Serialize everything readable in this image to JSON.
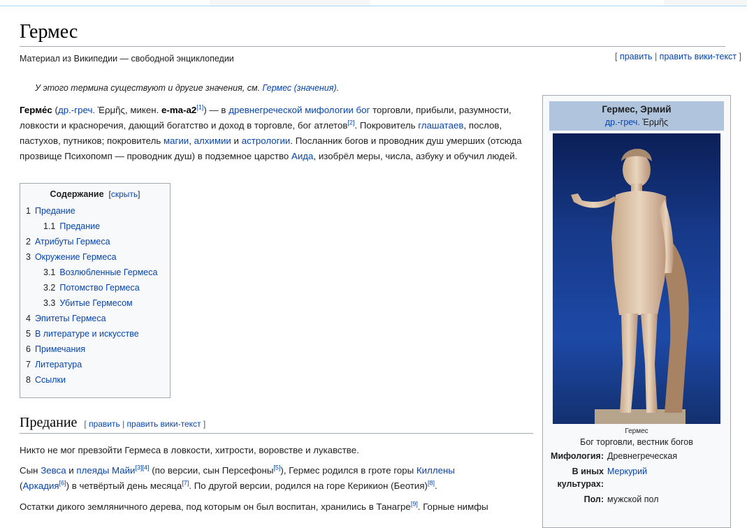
{
  "page": {
    "title": "Гермес",
    "tagline": "Материал из Википедии — свободной энциклопедии",
    "edit_links": [
      "[ ",
      "править",
      " | ",
      "править вики-текст",
      " ]"
    ],
    "hatnote_prefix": "У этого термина существуют и другие значения, см. ",
    "hatnote_link": "Гермес (значения)",
    "hatnote_suffix": "."
  },
  "lead": {
    "term": "Герме́с",
    "p1": " (",
    "lang_link": "др.-греч.",
    "greek": " Ἑρμῆς",
    "p2": ", микен. ",
    "myc": "e-ma-a2",
    "ref1": "[1]",
    "p3": ") — в ",
    "link_myth": "древнегреческой мифологии",
    "p4": " ",
    "link_god": "бог",
    "p5": " торговли, прибыли, разумности, ловкости и красноречия, дающий богатство и доход в торговле, бог атлетов",
    "ref2": "[2]",
    "p6": ". Покровитель ",
    "link_herald": "глашатаев",
    "p7": ", послов, пастухов, путников; покровитель ",
    "link_magic": "магии",
    "p8": ", ",
    "link_alch": "алхимии",
    "p9": " и ",
    "link_astro": "астрологии",
    "p10": ". Посланник богов и проводник душ умерших (отсюда прозвище Психопомп — проводник душ) в подземное царство ",
    "link_hades": "Аида",
    "p11": ", изобрёл меры, числа, азбуку и обучил людей."
  },
  "toc": {
    "heading": "Содержание",
    "hide_prefix": "[",
    "hide_link": "скрыть",
    "hide_suffix": "]",
    "items": [
      {
        "num": "1",
        "label": "Предание",
        "level": 1
      },
      {
        "num": "1.1",
        "label": "Предание",
        "level": 2
      },
      {
        "num": "2",
        "label": "Атрибуты Гермеса",
        "level": 1
      },
      {
        "num": "3",
        "label": "Окружение Гермеса",
        "level": 1
      },
      {
        "num": "3.1",
        "label": "Возлюбленные Гермеса",
        "level": 2
      },
      {
        "num": "3.2",
        "label": "Потомство Гермеса",
        "level": 2
      },
      {
        "num": "3.3",
        "label": "Убитые Гермесом",
        "level": 2
      },
      {
        "num": "4",
        "label": "Эпитеты Гермеса",
        "level": 1
      },
      {
        "num": "5",
        "label": "В литературе и искусстве",
        "level": 1
      },
      {
        "num": "6",
        "label": "Примечания",
        "level": 1
      },
      {
        "num": "7",
        "label": "Литература",
        "level": 1
      },
      {
        "num": "8",
        "label": "Ссылки",
        "level": 1
      }
    ]
  },
  "section": {
    "heading": "Предание",
    "edit_open": "[ ",
    "edit": "править",
    "sep": " | ",
    "edit_wiki": "править вики-текст",
    "edit_close": " ]",
    "para1": "Никто не мог превзойти Гермеса в ловкости, хитрости, воровстве и лукавстве.",
    "para2": {
      "t1": "Сын ",
      "zeus": "Зевса",
      "t2": " и ",
      "pleiad": "плеяды Майи",
      "r3": "[3]",
      "r4": "[4]",
      "t3": " (по версии, сын Персефоны",
      "r5": "[5]",
      "t4": "), Гермес родился в гроте горы ",
      "kyllene": "Киллены",
      "t5": " (",
      "arcadia": "Аркадия",
      "r6": "[6]",
      "t6": ") в четвёртый день месяца",
      "r7": "[7]",
      "t7": ". По другой версии, родился на горе Керикион (Беотия)",
      "r8": "[8]",
      "t8": "."
    },
    "para3": {
      "t1": "Остатки дикого земляничного дерева, под которым он был воспитан, хранились в Танагре",
      "r9": "[9]",
      "t2": ". Горные нимфы"
    }
  },
  "infobox": {
    "name": "Гермес, Эрмий",
    "lang_link": "др.-греч.",
    "greek": " Ἑρμῆς",
    "image_caption_small": "Гермес",
    "caption": "Бог торговли, вестник богов",
    "rows": [
      {
        "label": "Мифология:",
        "value": "Древнегреческая",
        "is_link": false
      },
      {
        "label": "В иных культурах:",
        "value": "Меркурий",
        "is_link": true
      },
      {
        "label": "Пол:",
        "value": "мужской пол",
        "is_link": false
      }
    ]
  },
  "colors": {
    "link": "#0645ad",
    "infobox_header": "#b0c4de",
    "border": "#a2a9b1"
  }
}
